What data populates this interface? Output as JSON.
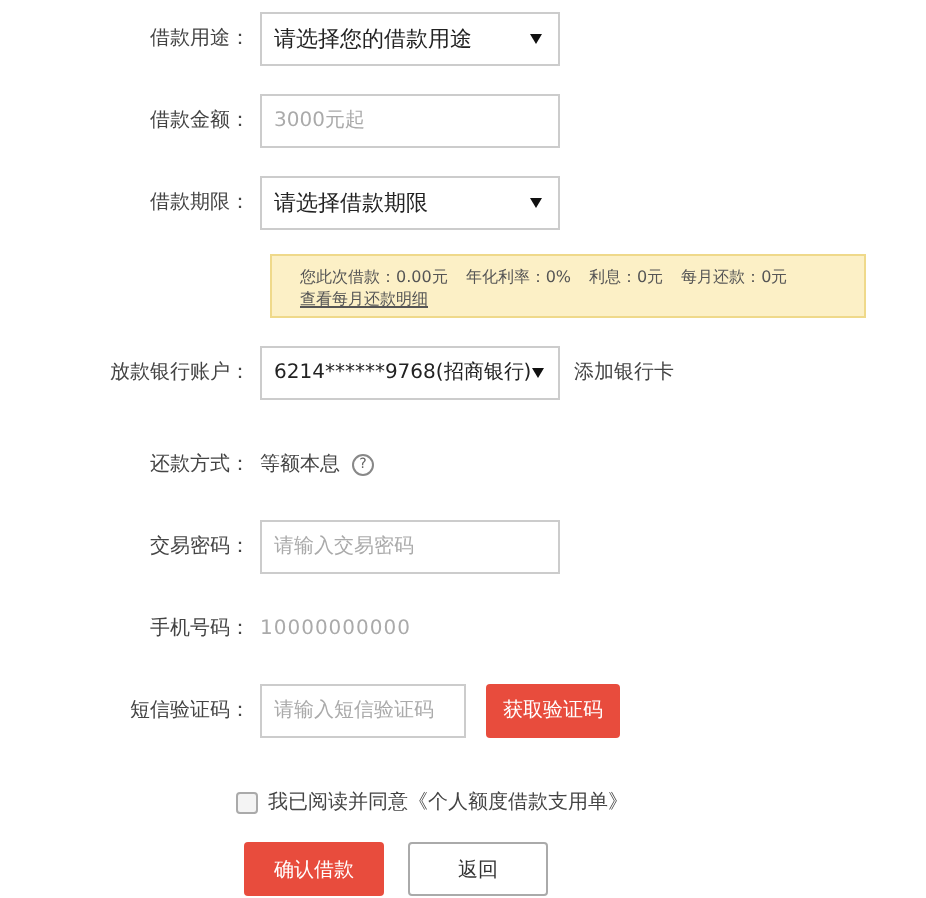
{
  "form": {
    "purpose": {
      "label": "借款用途：",
      "value": "请选择您的借款用途"
    },
    "amount": {
      "label": "借款金额：",
      "placeholder": "3000元起"
    },
    "term": {
      "label": "借款期限：",
      "value": "请选择借款期限"
    },
    "summary": {
      "items": [
        "您此次借款：0.00元",
        "年化利率：0%",
        "利息：0元",
        "每月还款：0元"
      ],
      "link": "查看每月还款明细"
    },
    "bank": {
      "label": "放款银行账户：",
      "value": "6214******9768(招商银行)",
      "add_link": "添加银行卡"
    },
    "repayment": {
      "label": "还款方式：",
      "value": "等额本息",
      "help": "?"
    },
    "password": {
      "label": "交易密码：",
      "placeholder": "请输入交易密码"
    },
    "phone": {
      "label": "手机号码：",
      "value": "10000000000"
    },
    "sms": {
      "label": "短信验证码：",
      "placeholder": "请输入短信验证码",
      "button": "获取验证码"
    },
    "agreement": {
      "checked": false,
      "text": "我已阅读并同意《个人额度借款支用单》"
    },
    "buttons": [
      {
        "kind": "primary",
        "label": "确认借款"
      },
      {
        "kind": "secondary",
        "label": "返回"
      }
    ]
  }
}
